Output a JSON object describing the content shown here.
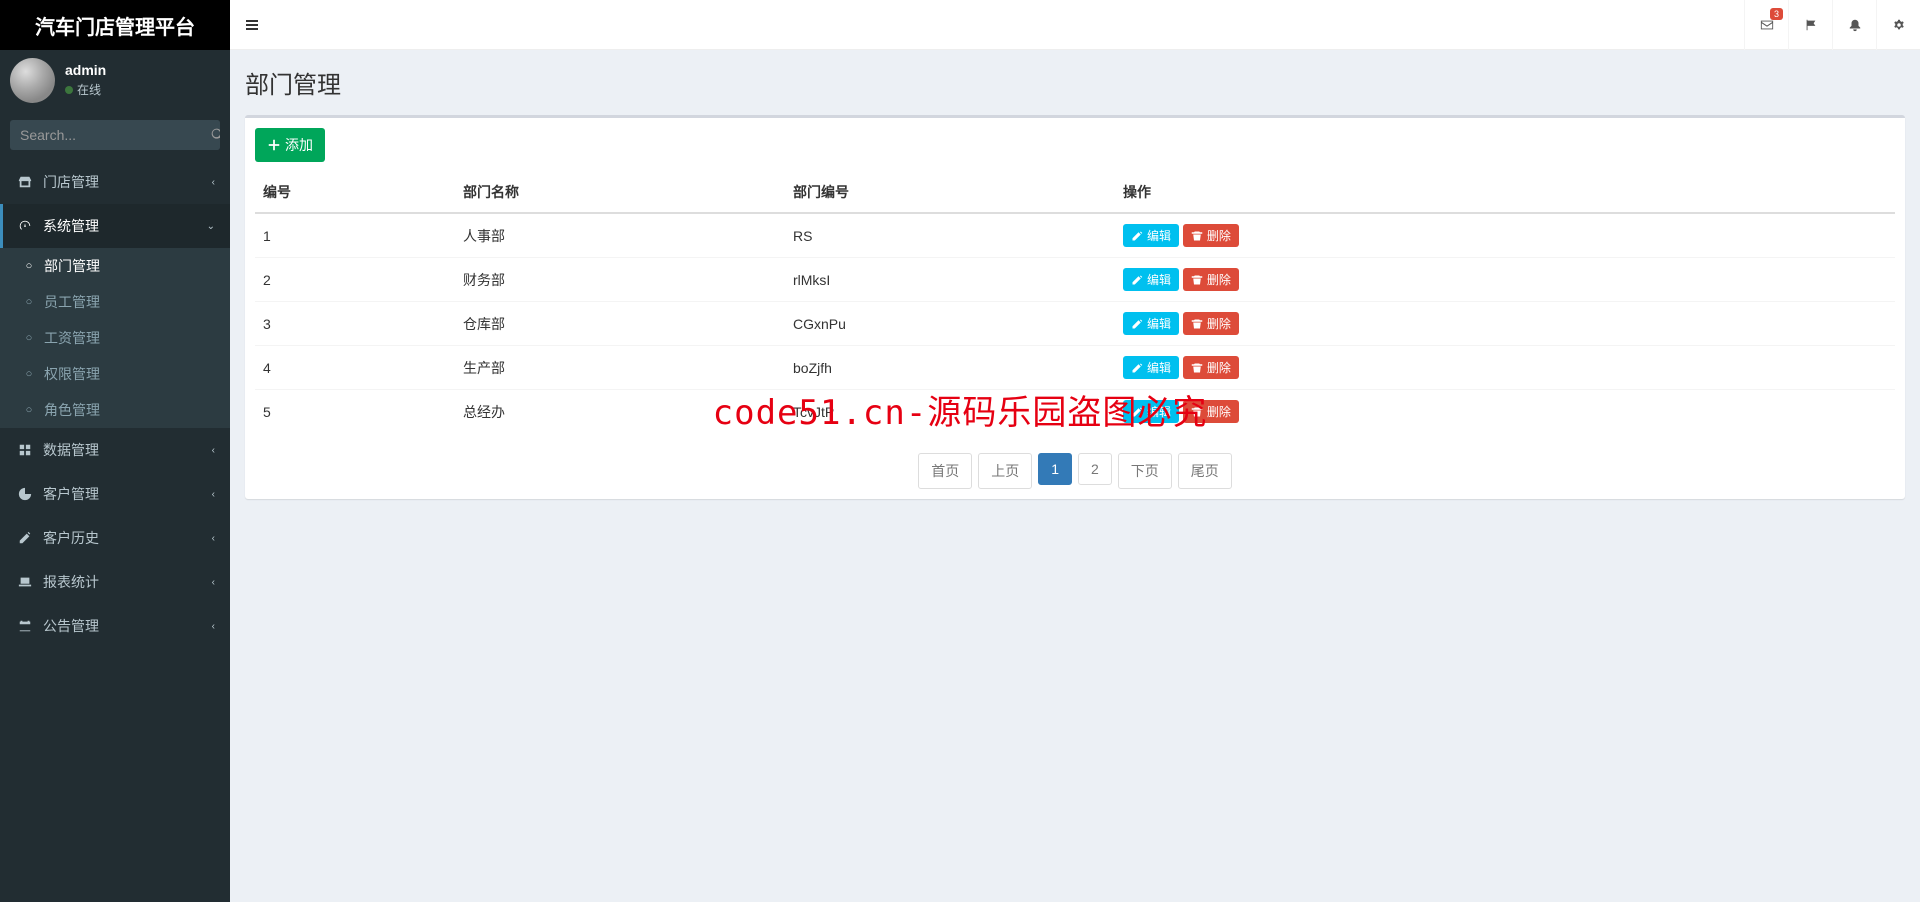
{
  "brand": "汽车门店管理平台",
  "user": {
    "name": "admin",
    "status": "在线"
  },
  "search": {
    "placeholder": "Search..."
  },
  "sidebar": {
    "items": [
      {
        "label": "门店管理"
      },
      {
        "label": "系统管理"
      },
      {
        "label": "数据管理"
      },
      {
        "label": "客户管理"
      },
      {
        "label": "客户历史"
      },
      {
        "label": "报表统计"
      },
      {
        "label": "公告管理"
      }
    ],
    "submenu": [
      {
        "label": "部门管理"
      },
      {
        "label": "员工管理"
      },
      {
        "label": "工资管理"
      },
      {
        "label": "权限管理"
      },
      {
        "label": "角色管理"
      }
    ]
  },
  "header_nav": {
    "mail_badge": "3"
  },
  "page": {
    "title": "部门管理",
    "add_btn": "添加"
  },
  "table": {
    "headers": {
      "id": "编号",
      "name": "部门名称",
      "code": "部门编号",
      "action": "操作"
    },
    "rows": [
      {
        "id": "1",
        "name": "人事部",
        "code": "RS"
      },
      {
        "id": "2",
        "name": "财务部",
        "code": "rlMksI"
      },
      {
        "id": "3",
        "name": "仓库部",
        "code": "CGxnPu"
      },
      {
        "id": "4",
        "name": "生产部",
        "code": "boZjfh"
      },
      {
        "id": "5",
        "name": "总经办",
        "code": "TcvJtP"
      }
    ],
    "edit_label": "编辑",
    "delete_label": "删除"
  },
  "pagination": {
    "first": "首页",
    "prev": "上页",
    "next": "下页",
    "last": "尾页",
    "pages": [
      "1",
      "2"
    ],
    "active": "1"
  },
  "watermark": "code51.cn-源码乐园盗图必究"
}
